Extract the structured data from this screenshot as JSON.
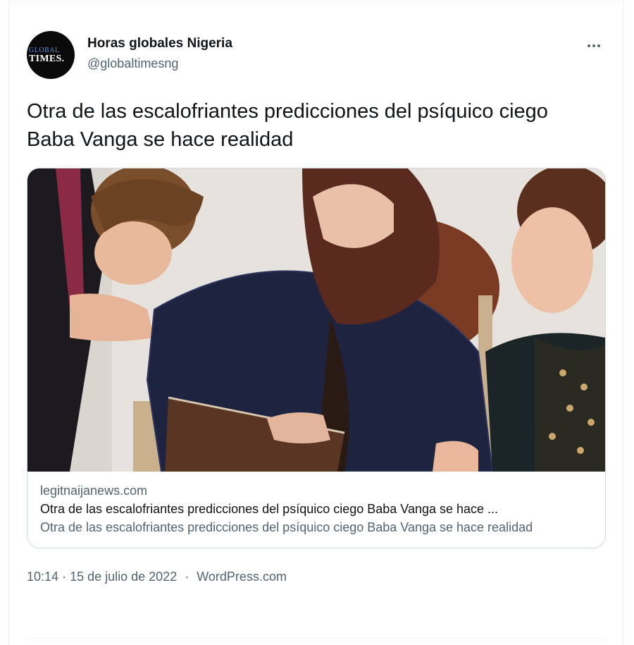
{
  "author": {
    "display_name": "Horas globales Nigeria",
    "handle": "@globaltimesng",
    "avatar_logo_top": "GLOBAL",
    "avatar_logo_bottom": "TIMES."
  },
  "more_icon": "more-horizontal-icon",
  "tweet_text": "Otra de las escalofriantes predicciones del psíquico ciego Baba Vanga se hace realidad",
  "card": {
    "domain": "legitnaijanews.com",
    "title": "Otra de las escalofriantes predicciones del psíquico ciego Baba Vanga se hace ...",
    "description": "Otra de las escalofriantes predicciones del psíquico ciego Baba Vanga se hace realidad"
  },
  "meta": {
    "time": "10:14",
    "date": "15 de julio de 2022",
    "source": "WordPress.com"
  },
  "colors": {
    "text_primary": "#0f1419",
    "text_secondary": "#536471",
    "border": "#cfd9de"
  }
}
